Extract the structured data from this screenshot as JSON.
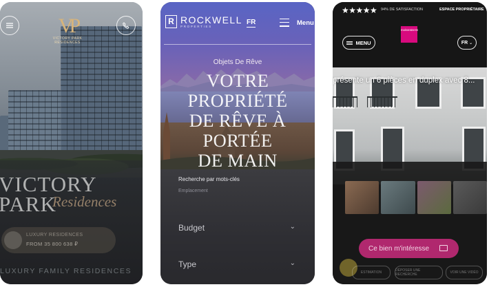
{
  "phone1": {
    "logo_name_line1": "VICTORY PARK",
    "logo_name_line2": "RESIDENCES",
    "title_line1": "VICTORY",
    "title_line2": "PARK",
    "title_script": "Residences",
    "card_line1": "LUXURY RESIDENCES",
    "card_line2": "FROM 35 800 638 ₽",
    "tagline": "LUXURY FAMILY RESIDENCES",
    "menu_icon": "hamburger-icon",
    "phone_icon": "phone-icon"
  },
  "phone2": {
    "brand": "ROCKWELL",
    "brand_sub": "PROPERTIES",
    "lang": "FR",
    "menu_label": "Menu",
    "eyebrow": "Objets De Rêve",
    "hero_line1": "VOTRE PROPRIÉTÉ",
    "hero_line2": "DE RÊVE À PORTÉE",
    "hero_line3": "DE MAIN",
    "search_label": "Recherche par mots-clés",
    "search_placeholder": "Emplacement",
    "budget_label": "Budget",
    "type_label": "Type"
  },
  "phone3": {
    "stars": "★★★★★",
    "satisfaction": "94% DE SATISFACTION",
    "espace": "ESPACE PROPRIÉTAIRE",
    "menu_label": "MENU",
    "logo_text": "maison&sens",
    "lang": "FR",
    "caption": "présente un 6 pièces en duplex avec 8...",
    "cta_label": "Ce bien m'intéresse",
    "pills": [
      "ESTIMATION",
      "DÉPOSER UNE RECHERCHE",
      "VOIR UNE VIDÉO"
    ],
    "accent": "#d80a7e"
  }
}
